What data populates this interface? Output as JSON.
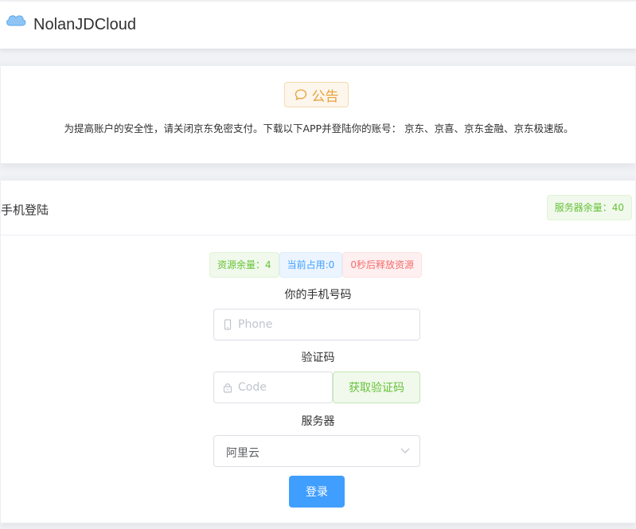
{
  "header": {
    "brand": "NolanJDCloud",
    "logo_icon": "cloud-icon"
  },
  "notice": {
    "tag_label": "公告",
    "tag_icon": "chat-bubble-icon",
    "text": "为提高账户的安全性，请关闭京东免密支付。下载以下APP并登陆你的账号： 京东、京喜、京东金融、京东极速版。"
  },
  "login": {
    "title": "手机登陆",
    "server_remaining": "服务器余量：40",
    "tags": {
      "resource_remaining": "资源余量：4",
      "current_usage": "当前占用:0",
      "release": "0秒后释放资源"
    },
    "phone": {
      "label": "你的手机号码",
      "placeholder": "Phone",
      "icon": "mobile-phone-icon"
    },
    "code": {
      "label": "验证码",
      "placeholder": "Code",
      "icon": "lock-icon",
      "button": "获取验证码"
    },
    "server": {
      "label": "服务器",
      "selected": "阿里云",
      "icon": "chevron-down-icon"
    },
    "submit": "登录"
  },
  "colors": {
    "primary": "#409eff",
    "success": "#67c23a",
    "warning": "#e6a23c",
    "danger": "#f56c6c"
  }
}
